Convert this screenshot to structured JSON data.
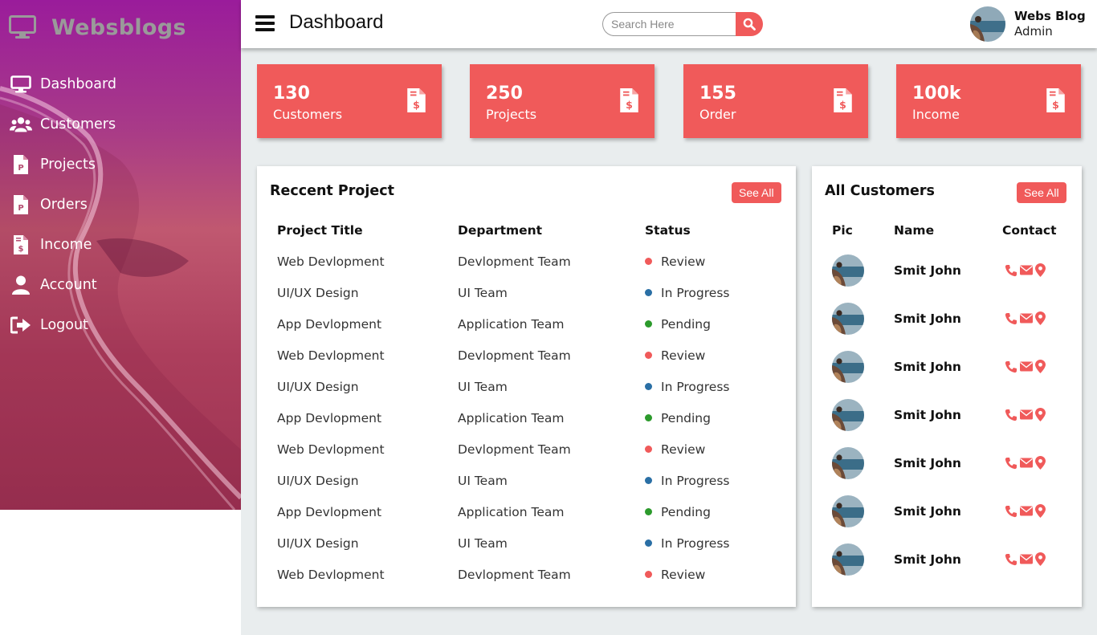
{
  "brand": {
    "name": "Websblogs"
  },
  "sidebar": {
    "items": [
      {
        "label": "Dashboard",
        "icon": "desktop-icon"
      },
      {
        "label": "Customers",
        "icon": "users-icon"
      },
      {
        "label": "Projects",
        "icon": "file-p-icon"
      },
      {
        "label": "Orders",
        "icon": "file-p-icon"
      },
      {
        "label": "Income",
        "icon": "file-invoice-dollar-icon"
      },
      {
        "label": "Account",
        "icon": "user-icon"
      },
      {
        "label": "Logout",
        "icon": "sign-out-icon"
      }
    ]
  },
  "header": {
    "title": "Dashboard",
    "search_placeholder": "Search Here",
    "user_name": "Webs Blog",
    "user_role": "Admin"
  },
  "cards": [
    {
      "value": "130",
      "label": "Customers",
      "icon": "file-invoice-dollar-icon"
    },
    {
      "value": "250",
      "label": "Projects",
      "icon": "file-invoice-dollar-icon"
    },
    {
      "value": "155",
      "label": "Order",
      "icon": "file-invoice-dollar-icon"
    },
    {
      "value": "100k",
      "label": "Income",
      "icon": "file-invoice-dollar-icon"
    }
  ],
  "recent_projects": {
    "title": "Reccent Project",
    "see_all": "See All",
    "headers": [
      "Project Title",
      "Department",
      "Status"
    ],
    "rows": [
      {
        "title": "Web Devlopment",
        "department": "Devlopment Team",
        "status": "Review"
      },
      {
        "title": "UI/UX Design",
        "department": "UI Team",
        "status": "In Progress"
      },
      {
        "title": "App Devlopment",
        "department": "Application Team",
        "status": "Pending"
      },
      {
        "title": "Web Devlopment",
        "department": "Devlopment Team",
        "status": "Review"
      },
      {
        "title": "UI/UX Design",
        "department": "UI Team",
        "status": "In Progress"
      },
      {
        "title": "App Devlopment",
        "department": "Application Team",
        "status": "Pending"
      },
      {
        "title": "Web Devlopment",
        "department": "Devlopment Team",
        "status": "Review"
      },
      {
        "title": "UI/UX Design",
        "department": "UI Team",
        "status": "In Progress"
      },
      {
        "title": "App Devlopment",
        "department": "Application Team",
        "status": "Pending"
      },
      {
        "title": "UI/UX Design",
        "department": "UI Team",
        "status": "In Progress"
      },
      {
        "title": "Web Devlopment",
        "department": "Devlopment Team",
        "status": "Review"
      }
    ],
    "status_colors": {
      "Review": "#f05a5a",
      "In Progress": "#2a6fa5",
      "Pending": "#2c9a2c"
    }
  },
  "customers": {
    "title": "All Customers",
    "see_all": "See All",
    "headers": [
      "Pic",
      "Name",
      "Contact"
    ],
    "rows": [
      {
        "name": "Smit John"
      },
      {
        "name": "Smit John"
      },
      {
        "name": "Smit John"
      },
      {
        "name": "Smit John"
      },
      {
        "name": "Smit John"
      },
      {
        "name": "Smit John"
      },
      {
        "name": "Smit John"
      }
    ],
    "contact_icons": [
      "phone-icon",
      "envelope-icon",
      "map-marker-icon"
    ]
  },
  "colors": {
    "accent": "#f05a5a",
    "sidebar_top": "#9a1c9b",
    "sidebar_bottom": "#9c3352",
    "brand_text": "#9a9a9a",
    "background": "#e9edee"
  }
}
